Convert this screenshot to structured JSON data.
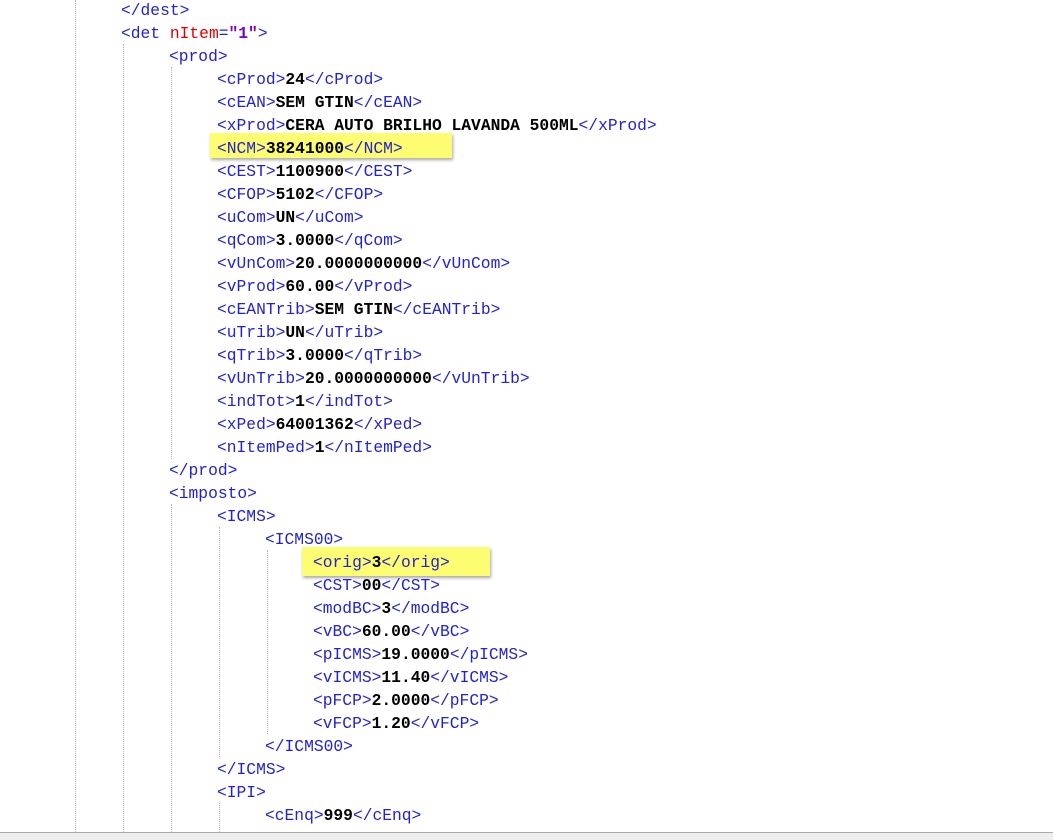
{
  "colors": {
    "tag": "#2323cc",
    "attribute_name": "#e00000",
    "attribute_value": "#8000c0",
    "text_value": "#000000",
    "highlight": "#fdfd72",
    "background": "#ffffff"
  },
  "lines": [
    {
      "open": "</dest>"
    },
    {
      "open": "<det ",
      "attr": "nItem",
      "eq": "=",
      "attr_value": "\"1\"",
      "close": ">"
    },
    {
      "open": "<prod>"
    },
    {
      "open": "<cProd>",
      "value": "24",
      "close": "</cProd>"
    },
    {
      "open": "<cEAN>",
      "value": "SEM GTIN",
      "close": "</cEAN>"
    },
    {
      "open": "<xProd>",
      "value": "CERA AUTO BRILHO LAVANDA 500ML",
      "close": "</xProd>"
    },
    {
      "open": "<NCM>",
      "value": "38241000",
      "close": "</NCM>",
      "highlighted": true
    },
    {
      "open": "<CEST>",
      "value": "1100900",
      "close": "</CEST>"
    },
    {
      "open": "<CFOP>",
      "value": "5102",
      "close": "</CFOP>"
    },
    {
      "open": "<uCom>",
      "value": "UN",
      "close": "</uCom>"
    },
    {
      "open": "<qCom>",
      "value": "3.0000",
      "close": "</qCom>"
    },
    {
      "open": "<vUnCom>",
      "value": "20.0000000000",
      "close": "</vUnCom>"
    },
    {
      "open": "<vProd>",
      "value": "60.00",
      "close": "</vProd>"
    },
    {
      "open": "<cEANTrib>",
      "value": "SEM GTIN",
      "close": "</cEANTrib>"
    },
    {
      "open": "<uTrib>",
      "value": "UN",
      "close": "</uTrib>"
    },
    {
      "open": "<qTrib>",
      "value": "3.0000",
      "close": "</qTrib>"
    },
    {
      "open": "<vUnTrib>",
      "value": "20.0000000000",
      "close": "</vUnTrib>"
    },
    {
      "open": "<indTot>",
      "value": "1",
      "close": "</indTot>"
    },
    {
      "open": "<xPed>",
      "value": "64001362",
      "close": "</xPed>"
    },
    {
      "open": "<nItemPed>",
      "value": "1",
      "close": "</nItemPed>"
    },
    {
      "open": "</prod>"
    },
    {
      "open": "<imposto>"
    },
    {
      "open": "<ICMS>"
    },
    {
      "open": "<ICMS00>"
    },
    {
      "open": "<orig>",
      "value": "3",
      "close": "</orig>",
      "highlighted": true
    },
    {
      "open": "<CST>",
      "value": "00",
      "close": "</CST>"
    },
    {
      "open": "<modBC>",
      "value": "3",
      "close": "</modBC>"
    },
    {
      "open": "<vBC>",
      "value": "60.00",
      "close": "</vBC>"
    },
    {
      "open": "<pICMS>",
      "value": "19.0000",
      "close": "</pICMS>"
    },
    {
      "open": "<vICMS>",
      "value": "11.40",
      "close": "</vICMS>"
    },
    {
      "open": "<pFCP>",
      "value": "2.0000",
      "close": "</pFCP>"
    },
    {
      "open": "<vFCP>",
      "value": "1.20",
      "close": "</vFCP>"
    },
    {
      "open": "</ICMS00>"
    },
    {
      "open": "</ICMS>"
    },
    {
      "open": "<IPI>"
    },
    {
      "open": "<cEnq>",
      "value": "999",
      "close": "</cEnq>"
    }
  ]
}
